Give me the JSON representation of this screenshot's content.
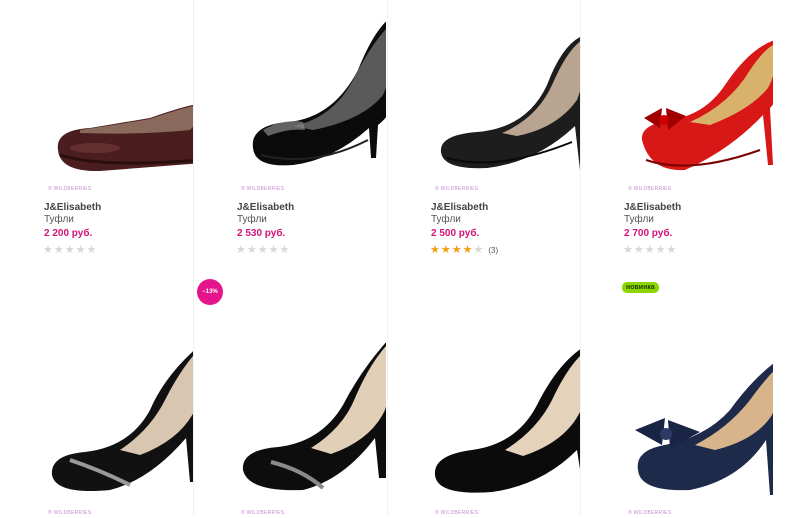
{
  "watermark": "® WILDBERRIES",
  "products_row1": [
    {
      "brand": "J&Elisabeth",
      "category": "Туфли",
      "price": "2 200 руб.",
      "rating": 0,
      "reviews": ""
    },
    {
      "brand": "J&Elisabeth",
      "category": "Туфли",
      "price": "2 530 руб.",
      "rating": 0,
      "reviews": ""
    },
    {
      "brand": "J&Elisabeth",
      "category": "Туфли",
      "price": "2 500 руб.",
      "rating": 4,
      "reviews": "(3)"
    },
    {
      "brand": "J&Elisabeth",
      "category": "Туфли",
      "price": "2 700 руб.",
      "rating": 0,
      "reviews": ""
    }
  ],
  "products_row2": [
    {
      "badge": "−13%"
    },
    {
      "badge": ""
    },
    {
      "badge": ""
    },
    {
      "badge": "новинка"
    }
  ],
  "colors": {
    "price": "#d3127a",
    "discount_badge": "#e6148c",
    "new_badge": "#8bd600",
    "star_on": "#f39c12",
    "star_off": "#d6d6d6"
  }
}
